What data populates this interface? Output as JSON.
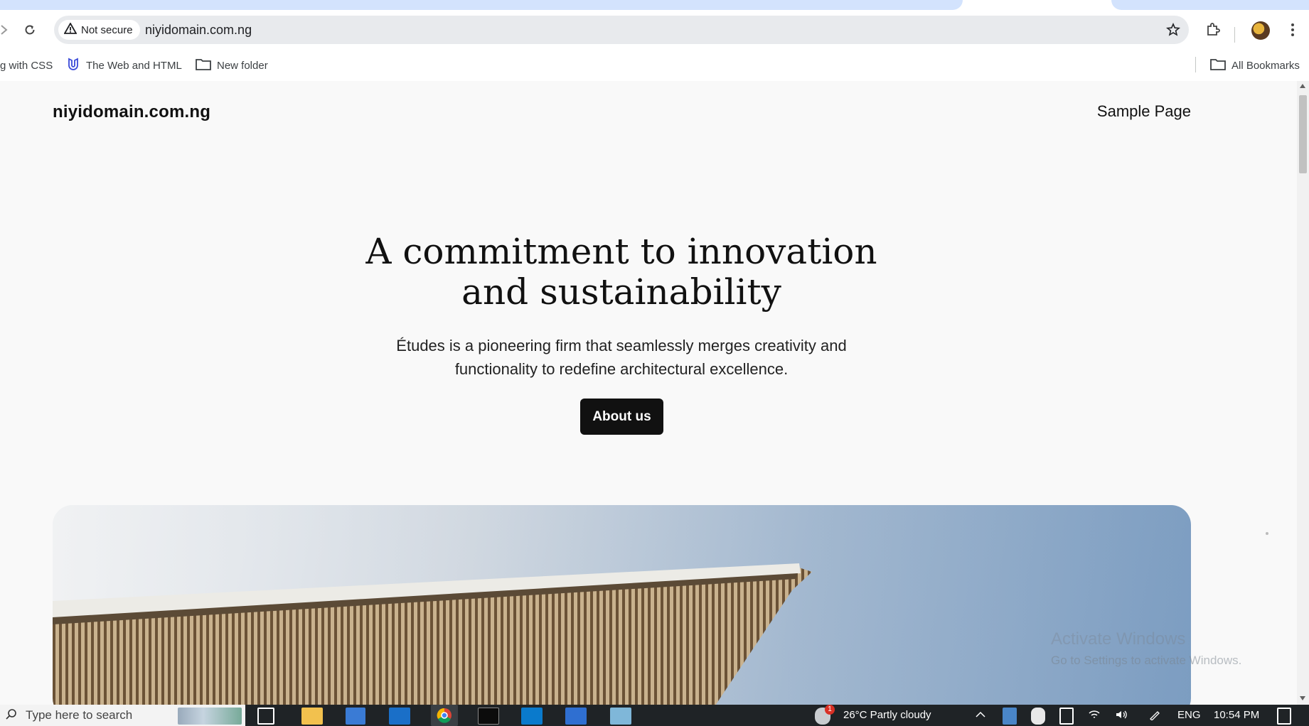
{
  "browser": {
    "security_label": "Not secure",
    "url": "niyidomain.com.ng",
    "bookmarks": [
      {
        "label": "g with CSS"
      },
      {
        "label": "The Web and HTML"
      },
      {
        "label": "New folder"
      }
    ],
    "all_bookmarks_label": "All Bookmarks"
  },
  "site": {
    "title": "niyidomain.com.ng",
    "nav_link": "Sample Page"
  },
  "hero": {
    "heading_line1": "A commitment to innovation",
    "heading_line2": "and sustainability",
    "text_line1": "Études is a pioneering firm that seamlessly merges creativity and",
    "text_line2": "functionality to redefine architectural excellence.",
    "button_label": "About us"
  },
  "watermark": {
    "line1": "Activate Windows",
    "line2": "Go to Settings to activate Windows."
  },
  "taskbar": {
    "search_placeholder": "Type here to search",
    "weather": "26°C  Partly cloudy",
    "weather_badge": "1",
    "language": "ENG",
    "time": "10:54 PM"
  },
  "colors": {
    "tab_accent": "#d3e3fd",
    "page_bg": "#f9f9f9",
    "button_bg": "#111111",
    "taskbar_bg": "#1f2326"
  }
}
